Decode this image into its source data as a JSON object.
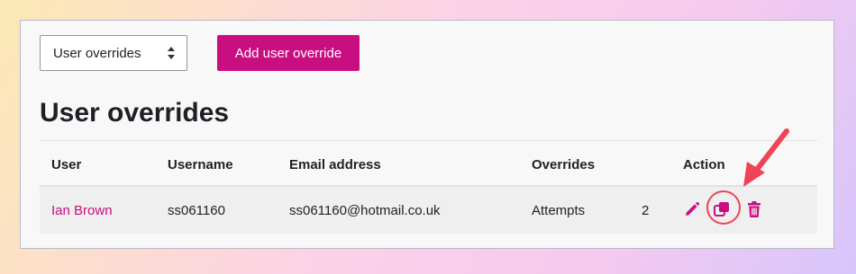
{
  "filter": {
    "selected": "User overrides"
  },
  "toolbar": {
    "add_label": "Add user override"
  },
  "page": {
    "title": "User overrides"
  },
  "table": {
    "headers": {
      "user": "User",
      "username": "Username",
      "email": "Email address",
      "overrides": "Overrides",
      "action": "Action"
    },
    "rows": [
      {
        "user": "Ian Brown",
        "username": "ss061160",
        "email": "ss061160@hotmail.co.uk",
        "override": "Attempts",
        "value": "2"
      }
    ]
  },
  "icons": {
    "edit": "pencil-icon",
    "duplicate": "copy-icon",
    "delete": "trash-icon",
    "select": "sort-chevron-icon"
  },
  "colors": {
    "accent": "#c90e80",
    "highlight": "#ef4455"
  }
}
